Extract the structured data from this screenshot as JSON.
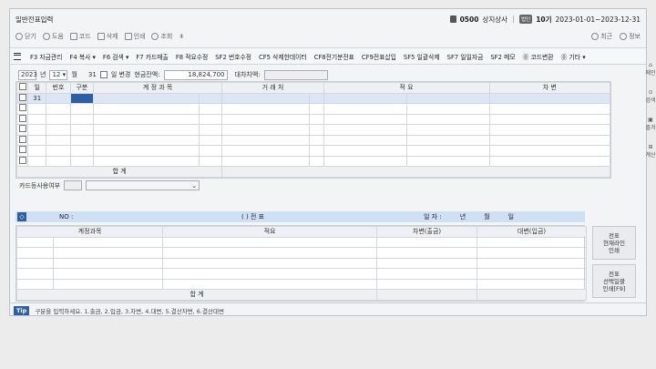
{
  "title": "일반전표입력",
  "company": {
    "code": "0500",
    "name": "상지상사",
    "badge": "법인",
    "period_num": "10기",
    "period_range": "2023-01-01~2023-12-31"
  },
  "toolbar": {
    "items": [
      "닫기",
      "도움",
      "코드",
      "삭제",
      "인쇄",
      "조회"
    ],
    "right": [
      "최근",
      "정보"
    ]
  },
  "fnbar": [
    "F3 자금관리",
    "F4 복사",
    "F6 검색",
    "F7 카드매출",
    "F8 적요수정",
    "SF2 번호수정",
    "CF5 삭제한데이터",
    "CF8전기분전표",
    "CF9전표삽입",
    "SF5 일괄삭제",
    "SF7 일일자금",
    "SF2 메모",
    "코드변환",
    "기타"
  ],
  "filter": {
    "year": "2023",
    "year_label": "년",
    "month": "12",
    "month_label": "월",
    "day": "31",
    "day_label": "일 변경",
    "cash_label": "현금잔액:",
    "cash_value": "18,824,700",
    "balance_label": "대차차액:"
  },
  "grid": {
    "headers": [
      "일",
      "번호",
      "구분",
      "계 정 과 목",
      "거 래 처",
      "적 요",
      "차 변",
      "대 변"
    ],
    "first_day": "31",
    "total_label": "합        계"
  },
  "card": {
    "label": "카드등사용여부"
  },
  "lower": {
    "no_label": "NO :",
    "voucher": "(          )    전    표",
    "date_label": "일  자 :",
    "year_label": "년",
    "month_label": "월",
    "day_label": "일",
    "headers": [
      "계정과목",
      "적요",
      "차변(출금)",
      "대변(입금)"
    ],
    "total_label": "합        계"
  },
  "side_buttons": [
    "전표\n현재라인\n인쇄",
    "전표\n선택일괄\n인쇄[F9]"
  ],
  "tip": {
    "badge": "Tip",
    "text": "구분을 입력하세요. 1.출금, 2.입금, 3.차변, 4.대변, 5.결산차변, 6.결산대변"
  },
  "rail": [
    "메인",
    "검색",
    "즐겨",
    "계산"
  ]
}
